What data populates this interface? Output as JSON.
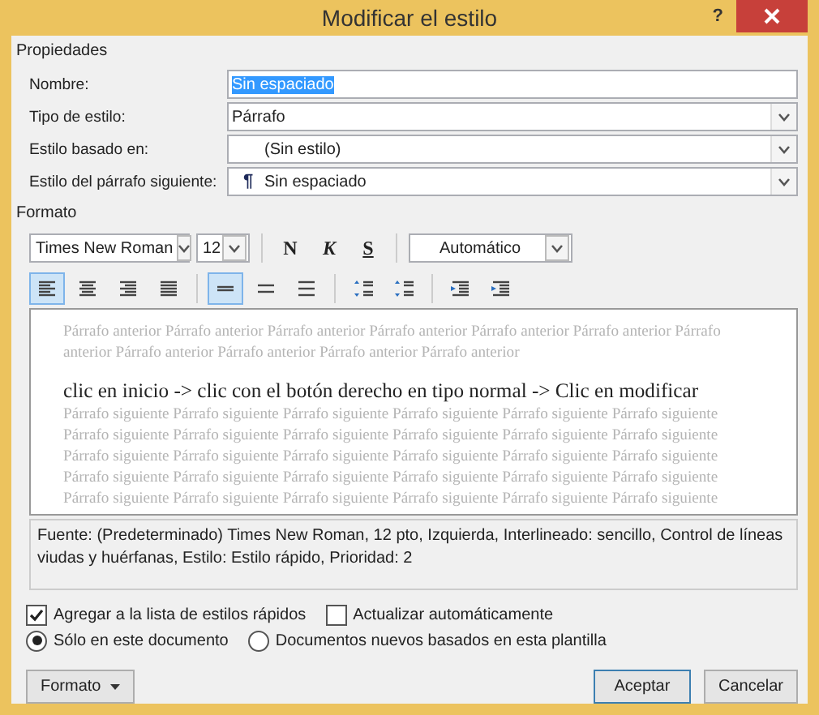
{
  "window": {
    "title": "Modificar el estilo",
    "help": "?"
  },
  "properties": {
    "heading": "Propiedades",
    "fields": [
      {
        "label": "Nombre:",
        "kind": "text",
        "value": "Sin espaciado",
        "highlighted": true
      },
      {
        "label": "Tipo de estilo:",
        "kind": "dropdown",
        "value": "Párrafo"
      },
      {
        "label": "Estilo basado en:",
        "kind": "style_dropdown",
        "value": "(Sin estilo)"
      },
      {
        "label": "Estilo del párrafo siguiente:",
        "kind": "style_dropdown",
        "mark": "¶",
        "value": "Sin espaciado"
      }
    ]
  },
  "format": {
    "heading": "Formato",
    "font": "Times New Roman",
    "size": "12",
    "bold": "N",
    "italic": "K",
    "underline": "S",
    "color_name": "Automático",
    "paragraph_toolbar": [
      [
        {
          "kind": "align-left",
          "selected": true
        },
        {
          "kind": "align-center",
          "selected": false
        },
        {
          "kind": "align-right",
          "selected": false
        },
        {
          "kind": "justify",
          "selected": false
        }
      ],
      [
        {
          "kind": "single",
          "selected": true
        },
        {
          "kind": "one-half",
          "selected": false
        },
        {
          "kind": "double",
          "selected": false
        }
      ],
      [
        {
          "kind": "space-before",
          "selected": false
        },
        {
          "kind": "space-after",
          "selected": false
        }
      ],
      [
        {
          "kind": "outdent",
          "selected": false
        },
        {
          "kind": "indent",
          "selected": false
        }
      ]
    ]
  },
  "preview": {
    "previous_lines": [
      "Párrafo anterior Párrafo anterior Párrafo anterior Párrafo anterior Párrafo anterior Párrafo anterior Párrafo",
      "anterior Párrafo anterior Párrafo anterior Párrafo anterior Párrafo anterior"
    ],
    "sample": "clic en inicio -> clic con el botón derecho en tipo normal -> Clic en modificar",
    "following_lines": [
      "Párrafo siguiente Párrafo siguiente Párrafo siguiente Párrafo siguiente Párrafo siguiente Párrafo siguiente",
      "Párrafo siguiente Párrafo siguiente Párrafo siguiente Párrafo siguiente Párrafo siguiente Párrafo siguiente",
      "Párrafo siguiente Párrafo siguiente Párrafo siguiente Párrafo siguiente Párrafo siguiente Párrafo siguiente",
      "Párrafo siguiente Párrafo siguiente Párrafo siguiente Párrafo siguiente Párrafo siguiente Párrafo siguiente",
      "Párrafo siguiente Párrafo siguiente Párrafo siguiente Párrafo siguiente Párrafo siguiente Párrafo siguiente"
    ]
  },
  "description": "Fuente: (Predeterminado) Times New Roman, 12 pto, Izquierda, Interlineado:  sencillo, Control de líneas viudas y huérfanas, Estilo: Estilo rápido, Prioridad: 2",
  "checkboxes": [
    {
      "label": "Agregar a la lista de estilos rápidos",
      "checked": true
    },
    {
      "label": "Actualizar automáticamente",
      "checked": false
    }
  ],
  "radios": [
    {
      "label": "Sólo en este documento",
      "selected": true
    },
    {
      "label": "Documentos nuevos basados en esta plantilla",
      "selected": false
    }
  ],
  "buttons": {
    "menu": "Formato",
    "ok": "Aceptar",
    "cancel": "Cancelar"
  }
}
